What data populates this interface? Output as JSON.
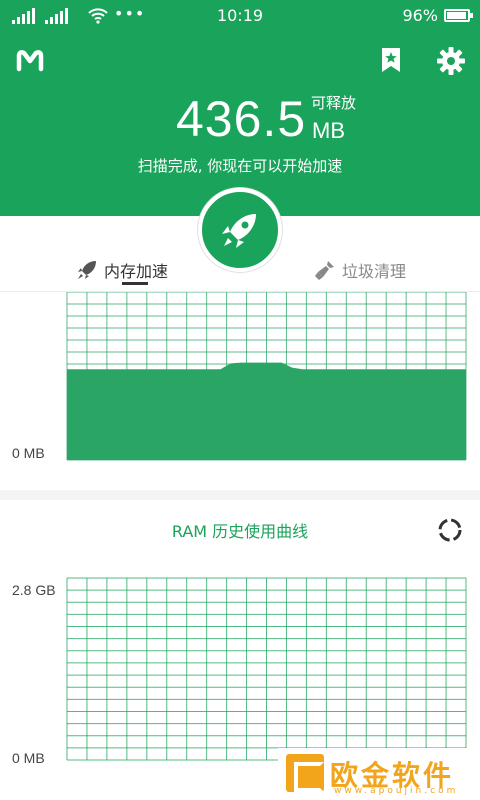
{
  "status_bar": {
    "time": "10:19",
    "battery_text": "96%",
    "battery_level": 0.96
  },
  "header": {
    "free_value": "436.5",
    "free_label": "可释放",
    "free_unit": "MB",
    "message": "扫描完成, 你现在可以开始加速"
  },
  "tabs": [
    {
      "label": "内存加速",
      "icon": "rocket-icon",
      "active": true
    },
    {
      "label": "垃圾清理",
      "icon": "broom-icon",
      "active": false
    }
  ],
  "memory_chart": {
    "y_min_label": "0 MB",
    "fill_color": "#2aa565",
    "grid_color": "#2aa565",
    "levels": [
      0.54,
      0.54,
      0.54,
      0.54,
      0.54,
      0.54,
      0.54,
      0.54,
      0.54,
      0.54,
      0.54,
      0.54,
      0.54,
      0.54,
      0.54,
      0.54,
      0.575,
      0.58,
      0.58,
      0.58,
      0.58,
      0.58,
      0.55,
      0.54,
      0.54,
      0.54,
      0.54,
      0.54,
      0.54,
      0.54,
      0.54,
      0.54,
      0.54,
      0.54,
      0.54,
      0.54,
      0.54,
      0.54,
      0.54,
      0.54
    ]
  },
  "ram_history": {
    "title": "RAM 历史使用曲线",
    "y_max_label": "2.8 GB",
    "y_min_label": "0 MB"
  },
  "watermark": {
    "text": "欧金软件园",
    "url": "www.apoujin.com"
  },
  "colors": {
    "brand": "#1aa35a",
    "accent": "#f2a51a"
  }
}
